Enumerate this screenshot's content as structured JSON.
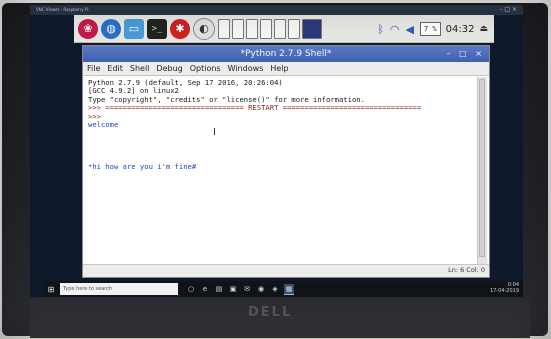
{
  "host_window": {
    "title": "VNC Viewer - Raspberry Pi",
    "controls": "– □ ×"
  },
  "rpi_panel": {
    "icons": [
      "raspberry-menu",
      "web-browser",
      "file-manager",
      "terminal",
      "settings",
      "wolfram"
    ],
    "cpu_usage": "7 %",
    "clock": "04:32",
    "eject_glyph": "⏏"
  },
  "shell": {
    "title": "*Python 2.7.9 Shell*",
    "window_controls": "– □ ×",
    "menu": [
      "File",
      "Edit",
      "Shell",
      "Debug",
      "Options",
      "Windows",
      "Help"
    ],
    "lines": [
      {
        "text": "Python 2.7.9 (default, Sep 17 2016, 20:26:04)",
        "kind": "normal"
      },
      {
        "text": "[GCC 4.9.2] on linux2",
        "kind": "normal"
      },
      {
        "text": "Type \"copyright\", \"credits\" or \"license()\" for more information.",
        "kind": "normal"
      },
      {
        "text": ">>> ================================ RESTART ================================",
        "kind": "restart"
      },
      {
        "text": ">>>",
        "kind": "prompt"
      },
      {
        "text": "welcome",
        "kind": "blue"
      },
      {
        "text": "",
        "kind": "normal"
      },
      {
        "text": "",
        "kind": "normal"
      },
      {
        "text": "",
        "kind": "normal"
      },
      {
        "text": "",
        "kind": "normal"
      },
      {
        "text": "*hi how are you i'm fine#",
        "kind": "blue"
      }
    ],
    "status": "Ln: 6 Col: 0"
  },
  "taskbar": {
    "search_placeholder": "Type here to search",
    "tray_time": "0:04",
    "tray_date": "17-04-2019",
    "start_glyph": "⊞"
  },
  "bezel": {
    "brand": "DELL"
  }
}
